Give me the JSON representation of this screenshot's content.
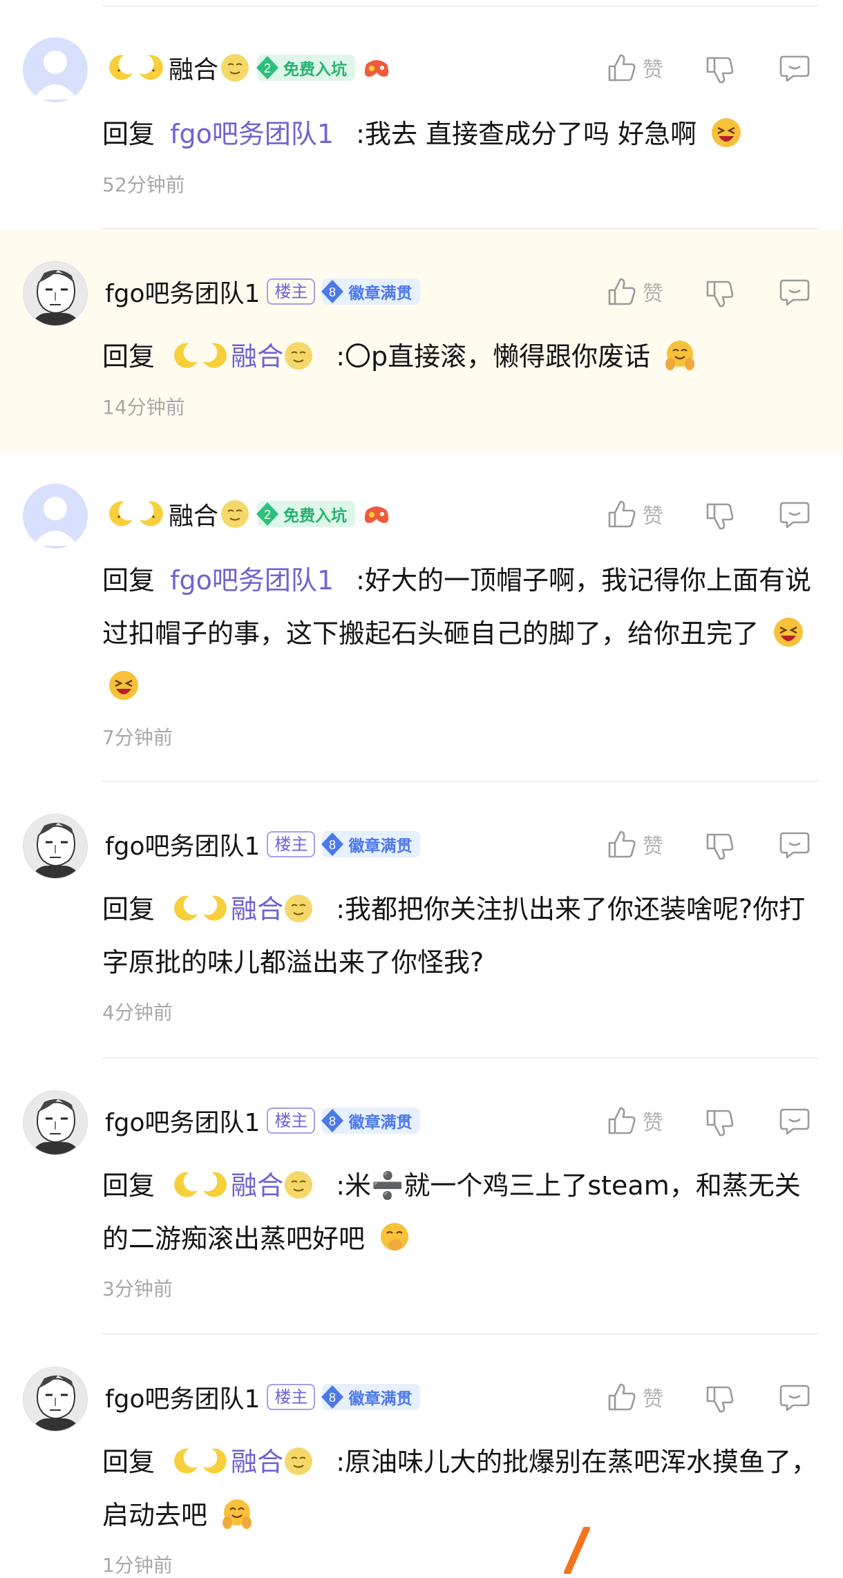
{
  "comments": [
    {
      "name": "融合",
      "badge_lz": "",
      "level": "2",
      "level_title": "免费入坑",
      "level_color": "green",
      "like_label": "赞",
      "reply_prefix": "回复",
      "reply_to": "fgo吧务团队1",
      "text": ":我去 直接查成分了吗 好急啊",
      "emoji": [
        "grin-face"
      ],
      "time": "52分钟前"
    },
    {
      "name": "fgo吧务团队1",
      "badge_lz": "楼主",
      "level": "8",
      "level_title": "徽章满贯",
      "level_color": "blue",
      "like_label": "赞",
      "reply_prefix": "回复",
      "reply_to": "融合",
      "text": ":〇p直接滚，懒得跟你废话",
      "emoji": [
        "hug-face"
      ],
      "time": "14分钟前"
    },
    {
      "name": "融合",
      "badge_lz": "",
      "level": "2",
      "level_title": "免费入坑",
      "level_color": "green",
      "like_label": "赞",
      "reply_prefix": "回复",
      "reply_to": "fgo吧务团队1",
      "text": ":好大的一顶帽子啊，我记得你上面有说过扣帽子的事，这下搬起石头砸自己的脚了，给你丑完了",
      "emoji": [
        "grin-face",
        "grin-face"
      ],
      "time": "7分钟前"
    },
    {
      "name": "fgo吧务团队1",
      "badge_lz": "楼主",
      "level": "8",
      "level_title": "徽章满贯",
      "level_color": "blue",
      "like_label": "赞",
      "reply_prefix": "回复",
      "reply_to": "融合",
      "text": ":我都把你关注扒出来了你还装啥呢?你打字原批的味儿都溢出来了你怪我?",
      "emoji": [],
      "time": "4分钟前"
    },
    {
      "name": "fgo吧务团队1",
      "badge_lz": "楼主",
      "level": "8",
      "level_title": "徽章满贯",
      "level_color": "blue",
      "like_label": "赞",
      "reply_prefix": "回复",
      "reply_to": "融合",
      "text": ":米➗就一个鸡三上了steam，和蒸无关的二游痴滚出蒸吧好吧",
      "emoji": [
        "shush-face"
      ],
      "time": "3分钟前"
    },
    {
      "name": "fgo吧务团队1",
      "badge_lz": "楼主",
      "level": "8",
      "level_title": "徽章满贯",
      "level_color": "blue",
      "like_label": "赞",
      "reply_prefix": "回复",
      "reply_to": "融合",
      "text": ":原油味儿大的批爆别在蒸吧浑水摸鱼了，启动去吧",
      "emoji": [
        "hug-face"
      ],
      "time": "1分钟前"
    }
  ],
  "colors": {
    "mention": "#6f62d2",
    "highlight_bg": "#fffbee",
    "badge_blue": "#4c78ea",
    "badge_green": "#24b36f"
  }
}
